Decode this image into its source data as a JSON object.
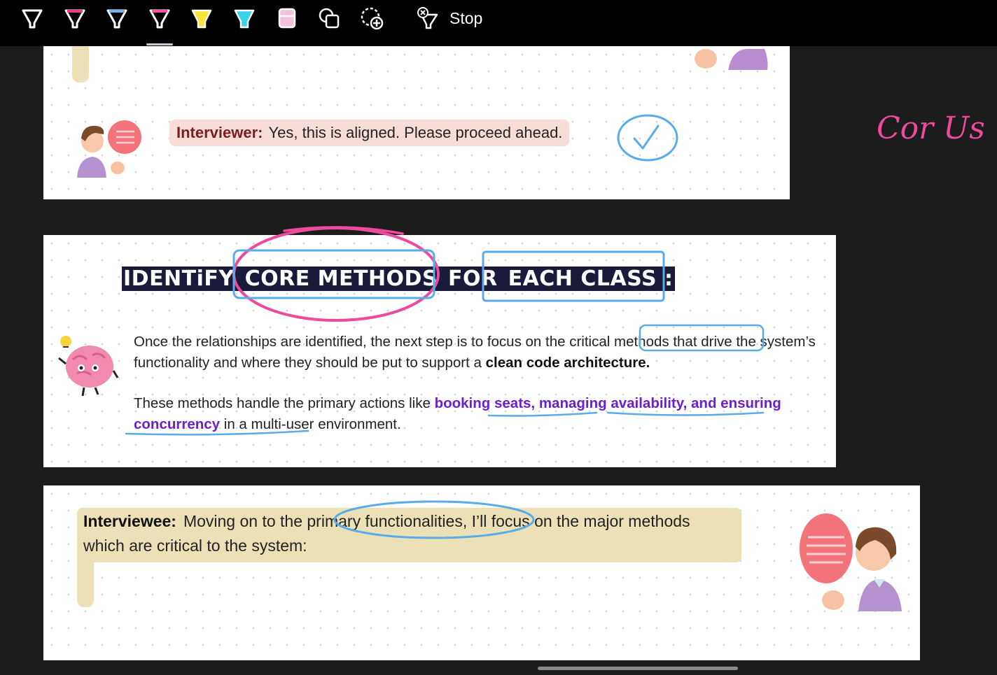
{
  "toolbar": {
    "tools": [
      {
        "name": "pen-white",
        "color": "#ffffff"
      },
      {
        "name": "pen-pink",
        "color": "#e83a86"
      },
      {
        "name": "pen-blue",
        "color": "#6ab4f0"
      },
      {
        "name": "pen-magenta-selected",
        "color": "#ff4fa6"
      },
      {
        "name": "highlighter-yellow",
        "color": "#f5e63a"
      },
      {
        "name": "highlighter-cyan",
        "color": "#3ad4e8"
      },
      {
        "name": "eraser",
        "color": "#f3c2da"
      },
      {
        "name": "shapes",
        "color": "#ffffff"
      },
      {
        "name": "lasso-add",
        "color": "#ffffff"
      }
    ],
    "stop_label": "Stop"
  },
  "page1": {
    "interviewer_label": "Interviewer:",
    "interviewer_text": "Yes, this is aligned. Please proceed ahead."
  },
  "page2": {
    "heading": {
      "part1": "IDENTiFY ",
      "part2": "CORE METHODS",
      "part3": " FOR ",
      "part4": "EACH CLASS :"
    },
    "para1": {
      "t1": "Once the relationships are identified, the next step is to focus on the ",
      "t2": "critical methods",
      "t3": " that drive the system’s functionality and where they should be put to support a ",
      "bold": "clean code architecture."
    },
    "para2": {
      "t1": "These methods handle the primary actions like ",
      "hl": "booking seats, managing availability, and ensuring concurrency",
      "t2": " in a multi-user environment."
    }
  },
  "page3": {
    "interviewee_label": "Interviewee:",
    "interviewee_text": "Moving on to the primary functionalities, I’ll focus on the major methods which are critical to the system:"
  },
  "annotations": {
    "side_note": "Cor Us",
    "pink": "#ec4b9c",
    "blue": "#5aabea"
  }
}
